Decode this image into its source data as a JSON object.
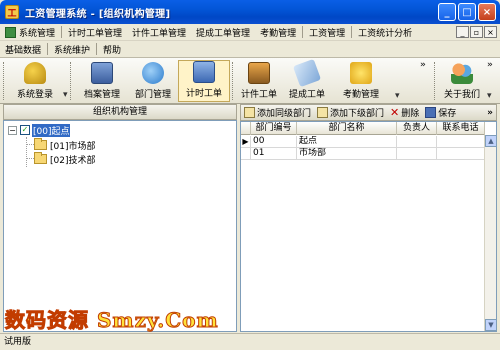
{
  "window": {
    "title": "工资管理系统 - [组织机构管理]",
    "app_icon": "工",
    "buttons": {
      "minimize": "_",
      "maximize": "□",
      "close": "×"
    }
  },
  "menu_row1": [
    "系统管理",
    "计时工单管理",
    "计件工单管理",
    "提成工单管理",
    "考勤管理",
    "工资管理",
    "工资统计分析"
  ],
  "menu_row2": [
    "基础数据",
    "系统维护",
    "帮助"
  ],
  "mdi_buttons": [
    "_",
    "▫",
    "×"
  ],
  "toolbar": {
    "login": "系统登录",
    "archive": "档案管理",
    "department": "部门管理",
    "timecard": "计时工单",
    "piecework": "计件工单",
    "commission": "提成工单",
    "attendance": "考勤管理",
    "about": "关于我们",
    "overflow": "»"
  },
  "left_panel": {
    "header": "组织机构管理",
    "tree": {
      "root": "[00]起点",
      "children": [
        "[01]市场部",
        "[02]技术部"
      ]
    }
  },
  "right_toolbar": {
    "add_sibling": "添加同级部门",
    "add_child": "添加下级部门",
    "delete": "删除",
    "save": "保存",
    "delete_glyph": "✕",
    "overflow": "»"
  },
  "grid": {
    "columns": [
      "",
      "部门编号",
      "部门名称",
      "负责人",
      "联系电话"
    ],
    "rows": [
      {
        "indicator": "▶",
        "code": "00",
        "name": "起点",
        "manager": "",
        "phone": ""
      },
      {
        "indicator": "",
        "code": "01",
        "name": "市场部",
        "manager": "",
        "phone": ""
      }
    ]
  },
  "watermark": "数码资源 Smzy.Com",
  "statusbar": "试用版",
  "colors": {
    "titlebar": "#0355D6",
    "chrome": "#ECE9D8",
    "selection": "#316AC5",
    "watermark": "#FFE23A"
  }
}
